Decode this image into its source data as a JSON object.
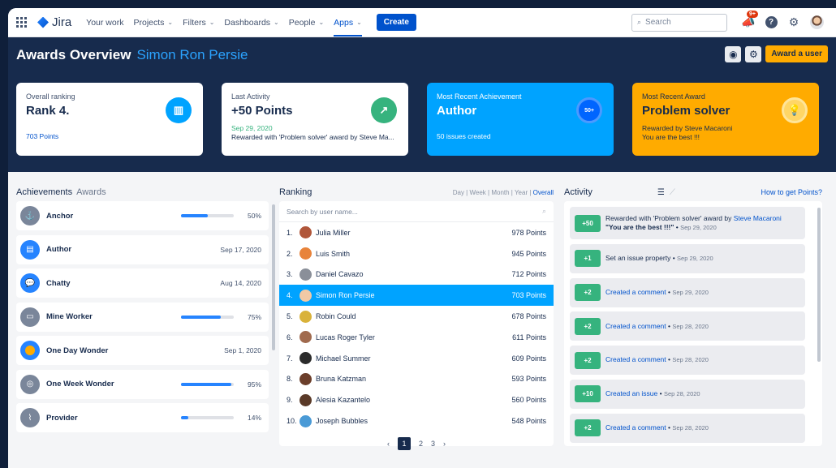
{
  "nav": {
    "logo": "Jira",
    "items": [
      {
        "label": "Your work"
      },
      {
        "label": "Projects"
      },
      {
        "label": "Filters"
      },
      {
        "label": "Dashboards"
      },
      {
        "label": "People"
      },
      {
        "label": "Apps"
      }
    ],
    "create_label": "Create",
    "search_placeholder": "Search",
    "notif_count": "9+"
  },
  "hero": {
    "title": "Awards Overview",
    "user_name": "Simon Ron Persie",
    "award_button": "Award a user"
  },
  "cards": [
    {
      "label": "Overall ranking",
      "value": "Rank 4.",
      "sub": "703 Points",
      "sub2": ""
    },
    {
      "label": "Last Activity",
      "value": "+50 Points",
      "sub": "Sep 29, 2020",
      "sub2": "Rewarded with 'Problem solver' award by Steve Ma..."
    },
    {
      "label": "Most Recent Achievement",
      "value": "Author",
      "sub": "50 issues created",
      "sub2": "",
      "icon_text": "50+"
    },
    {
      "label": "Most Recent Award",
      "value": "Problem solver",
      "sub": "Rewarded by Steve Macaroni",
      "sub2": "You are the best !!!"
    }
  ],
  "achievements": {
    "tab_active": "Achievements",
    "tab_other": "Awards",
    "items": [
      {
        "name": "Anchor",
        "progress": "50%",
        "date": ""
      },
      {
        "name": "Author",
        "progress": "",
        "date": "Sep 17, 2020"
      },
      {
        "name": "Chatty",
        "progress": "",
        "date": "Aug 14, 2020"
      },
      {
        "name": "Mine Worker",
        "progress": "75%",
        "date": ""
      },
      {
        "name": "One Day Wonder",
        "progress": "",
        "date": "Sep 1, 2020"
      },
      {
        "name": "One Week Wonder",
        "progress": "95%",
        "date": ""
      },
      {
        "name": "Provider",
        "progress": "14%",
        "date": ""
      }
    ]
  },
  "ranking": {
    "title": "Ranking",
    "filters": [
      "Day",
      "Week",
      "Month",
      "Year",
      "Overall"
    ],
    "search_placeholder": "Search by user name...",
    "rows": [
      {
        "rank": "1.",
        "name": "Julia Miller",
        "points": "978 Points"
      },
      {
        "rank": "2.",
        "name": "Luis Smith",
        "points": "945 Points"
      },
      {
        "rank": "3.",
        "name": "Daniel Cavazo",
        "points": "712 Points"
      },
      {
        "rank": "4.",
        "name": "Simon Ron Persie",
        "points": "703 Points"
      },
      {
        "rank": "5.",
        "name": "Robin Could",
        "points": "678 Points"
      },
      {
        "rank": "6.",
        "name": "Lucas Roger Tyler",
        "points": "611 Points"
      },
      {
        "rank": "7.",
        "name": "Michael Summer",
        "points": "609 Points"
      },
      {
        "rank": "8.",
        "name": "Bruna Katzman",
        "points": "593 Points"
      },
      {
        "rank": "9.",
        "name": "Alesia Kazantelo",
        "points": "560 Points"
      },
      {
        "rank": "10.",
        "name": "Joseph Bubbles",
        "points": "548 Points"
      }
    ],
    "pages": [
      "1",
      "2",
      "3"
    ]
  },
  "activity": {
    "title": "Activity",
    "link": "How to get Points?",
    "items": [
      {
        "points": "+50",
        "text": "Rewarded with 'Problem solver' award by ",
        "link": "Steve Macaroni",
        "extra": "\"You are the best !!!\"",
        "date": "Sep 29, 2020"
      },
      {
        "points": "+1",
        "text": "Set an issue property",
        "link": "",
        "extra": "",
        "date": "Sep 29, 2020"
      },
      {
        "points": "+2",
        "text": "",
        "link": "Created a comment",
        "extra": "",
        "date": "Sep 29, 2020"
      },
      {
        "points": "+2",
        "text": "",
        "link": "Created a comment",
        "extra": "",
        "date": "Sep 28, 2020"
      },
      {
        "points": "+2",
        "text": "",
        "link": "Created a comment",
        "extra": "",
        "date": "Sep 28, 2020"
      },
      {
        "points": "+10",
        "text": "",
        "link": "Created an issue",
        "extra": "",
        "date": "Sep 28, 2020"
      },
      {
        "points": "+2",
        "text": "",
        "link": "Created a comment",
        "extra": "",
        "date": "Sep 28, 2020"
      }
    ]
  },
  "colors": {
    "accent": "#0052cc",
    "hero_bg": "#172b4d",
    "card_blue": "#00a3ff",
    "card_yellow": "#ffab00",
    "green": "#36b37e"
  }
}
